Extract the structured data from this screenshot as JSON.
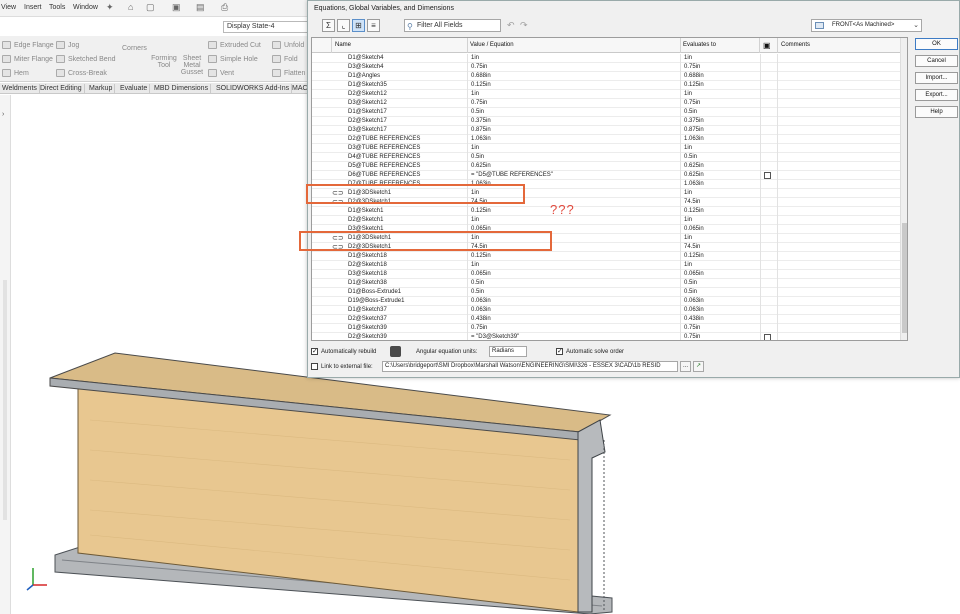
{
  "app": {
    "menu": [
      "View",
      "Insert",
      "Tools",
      "Window"
    ],
    "config_state": "Display State-4",
    "ribbon": {
      "row1": [
        "Edge Flange",
        "Jog",
        "Corners",
        "Extruded Cut",
        "Unfold"
      ],
      "row2": [
        "Miter Flange",
        "Sketched Bend",
        "Forming Tool",
        "Sheet Metal Gusset",
        "Simple Hole",
        "Fold"
      ],
      "row3": [
        "Hem",
        "Cross-Break",
        "Vent",
        "Flatten"
      ]
    },
    "tabs": [
      "Weldments",
      "Direct Editing",
      "Markup",
      "Evaluate",
      "MBD Dimensions",
      "SOLIDWORKS Add-Ins",
      "MAC"
    ]
  },
  "dialog": {
    "title": "Equations, Global Variables, and Dimensions",
    "filter_placeholder": "Filter All Fields",
    "view_select": "FRONT<As Machined>",
    "columns": {
      "name": "Name",
      "value": "Value / Equation",
      "evaluates": "Evaluates to",
      "comments": "Comments"
    },
    "rows": [
      {
        "name": "D1@Sketch4",
        "value": "1in",
        "eval": "1in"
      },
      {
        "name": "D3@Sketch4",
        "value": "0.75in",
        "eval": "0.75in"
      },
      {
        "name": "D1@Angles",
        "value": "0.688in",
        "eval": "0.688in"
      },
      {
        "name": "D1@Sketch35",
        "value": "0.125in",
        "eval": "0.125in"
      },
      {
        "name": "D2@Sketch12",
        "value": "1in",
        "eval": "1in"
      },
      {
        "name": "D3@Sketch12",
        "value": "0.75in",
        "eval": "0.75in"
      },
      {
        "name": "D1@Sketch17",
        "value": "0.5in",
        "eval": "0.5in"
      },
      {
        "name": "D2@Sketch17",
        "value": "0.375in",
        "eval": "0.375in"
      },
      {
        "name": "D3@Sketch17",
        "value": "0.875in",
        "eval": "0.875in"
      },
      {
        "name": "D2@TUBE REFERENCES",
        "value": "1.063in",
        "eval": "1.063in"
      },
      {
        "name": "D3@TUBE REFERENCES",
        "value": "1in",
        "eval": "1in"
      },
      {
        "name": "D4@TUBE REFERENCES",
        "value": "0.5in",
        "eval": "0.5in"
      },
      {
        "name": "D5@TUBE REFERENCES",
        "value": "0.625in",
        "eval": "0.625in"
      },
      {
        "name": "D6@TUBE REFERENCES",
        "value": "= \"D5@TUBE REFERENCES\"",
        "eval": "0.625in",
        "checkbox": true
      },
      {
        "name": "D7@TUBE REFERENCES",
        "value": "1.063in",
        "eval": "1.063in"
      },
      {
        "name": "D1@3DSketch1",
        "value": "1in",
        "eval": "1in",
        "linked": true
      },
      {
        "name": "D2@3DSketch1",
        "value": "74.5in",
        "eval": "74.5in",
        "linked": true
      },
      {
        "name": "D1@Sketch1",
        "value": "0.125in",
        "eval": "0.125in"
      },
      {
        "name": "D2@Sketch1",
        "value": "1in",
        "eval": "1in"
      },
      {
        "name": "D3@Sketch1",
        "value": "0.065in",
        "eval": "0.065in"
      },
      {
        "name": "D1@3DSketch1",
        "value": "1in",
        "eval": "1in",
        "linked": true
      },
      {
        "name": "D2@3DSketch1",
        "value": "74.5in",
        "eval": "74.5in",
        "linked": true
      },
      {
        "name": "D1@Sketch18",
        "value": "0.125in",
        "eval": "0.125in"
      },
      {
        "name": "D2@Sketch18",
        "value": "1in",
        "eval": "1in"
      },
      {
        "name": "D3@Sketch18",
        "value": "0.065in",
        "eval": "0.065in"
      },
      {
        "name": "D1@Sketch38",
        "value": "0.5in",
        "eval": "0.5in"
      },
      {
        "name": "D1@Boss-Extrude1",
        "value": "0.5in",
        "eval": "0.5in"
      },
      {
        "name": "D19@Boss-Extrude1",
        "value": "0.063in",
        "eval": "0.063in"
      },
      {
        "name": "D1@Sketch37",
        "value": "0.063in",
        "eval": "0.063in"
      },
      {
        "name": "D2@Sketch37",
        "value": "0.438in",
        "eval": "0.438in"
      },
      {
        "name": "D1@Sketch39",
        "value": "0.75in",
        "eval": "0.75in"
      },
      {
        "name": "D2@Sketch39",
        "value": "= \"D3@Sketch39\"",
        "eval": "0.75in",
        "checkbox": true
      }
    ],
    "bottom": {
      "auto_rebuild": "Automatically rebuild",
      "angle_units_label": "Angular equation units:",
      "angle_units_value": "Radians",
      "auto_solve": "Automatic solve order",
      "link_external": "Link to external file:",
      "external_path": "C:\\Users\\bridgeport\\SMI Dropbox\\Marshall Watson\\ENGINEERING\\SMI\\326 - ESSEX 3\\CAD\\1b RESID",
      "browse": "..."
    },
    "buttons": {
      "ok": "OK",
      "cancel": "Cancel",
      "import": "Import...",
      "export": "Export...",
      "help": "Help"
    }
  },
  "annotation": {
    "question": "???",
    "color": "#e4683a"
  },
  "colors": {
    "wood": "#e9c892",
    "frame": "#a8acb0",
    "accent": "#3d7bc4"
  }
}
